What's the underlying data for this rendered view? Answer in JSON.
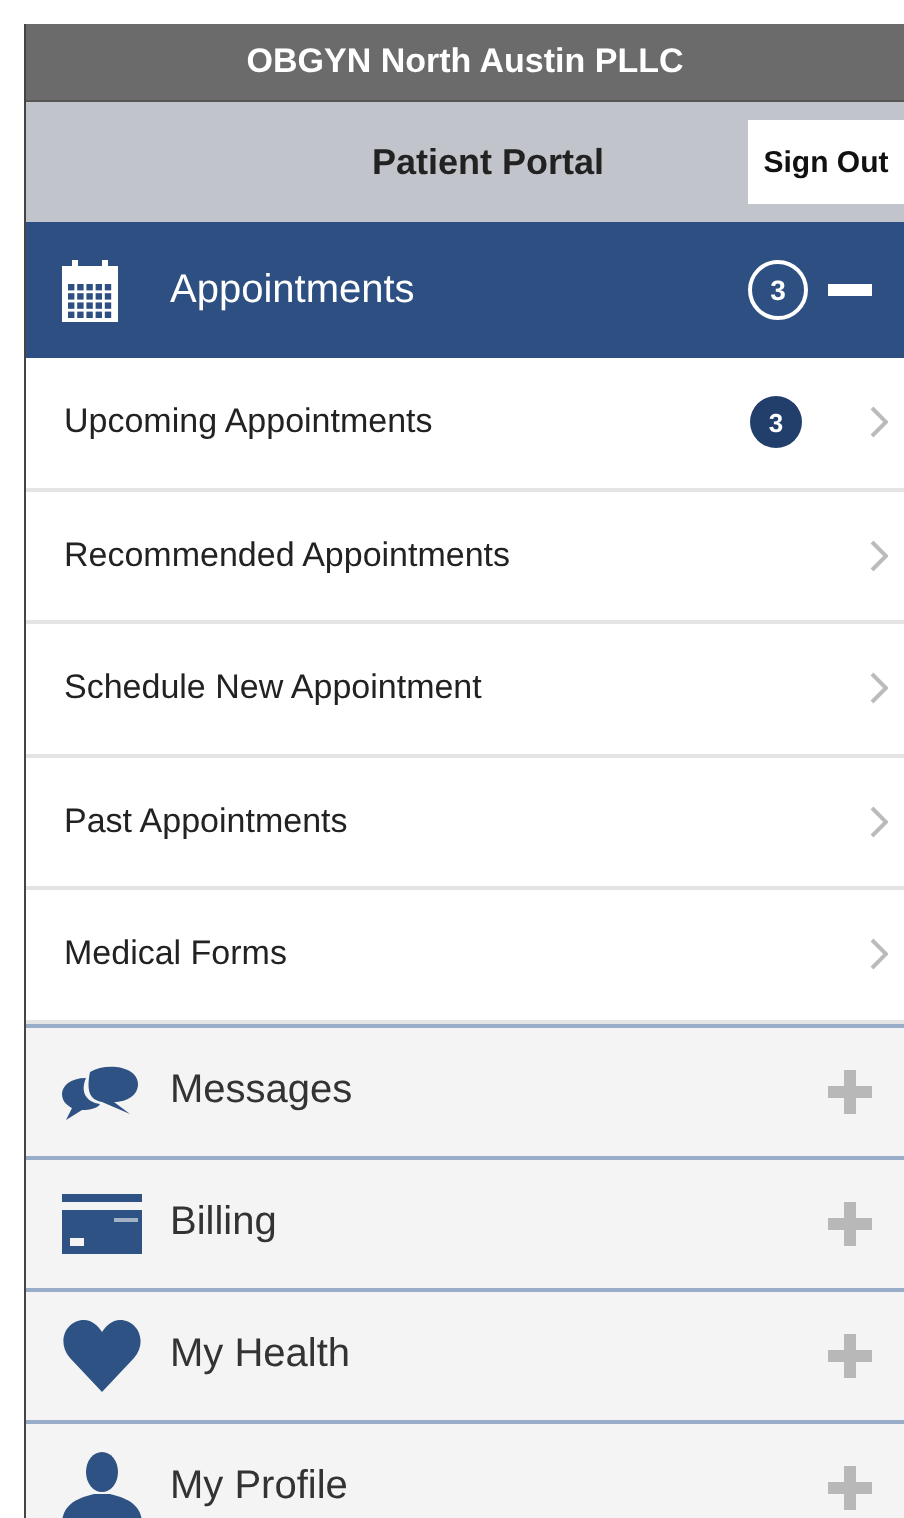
{
  "header": {
    "title": "OBGYN North Austin PLLC"
  },
  "toolbar": {
    "title": "Patient Portal",
    "sign_out": "Sign Out"
  },
  "sections": [
    {
      "label": "Appointments",
      "expanded": true,
      "badge": "3",
      "items": [
        {
          "label": "Upcoming Appointments",
          "badge": "3"
        },
        {
          "label": "Recommended Appointments"
        },
        {
          "label": "Schedule New Appointment"
        },
        {
          "label": "Past Appointments"
        },
        {
          "label": "Medical Forms"
        }
      ]
    },
    {
      "label": "Messages",
      "expanded": false
    },
    {
      "label": "Billing",
      "expanded": false
    },
    {
      "label": "My Health",
      "expanded": false
    },
    {
      "label": "My Profile",
      "expanded": false
    }
  ]
}
